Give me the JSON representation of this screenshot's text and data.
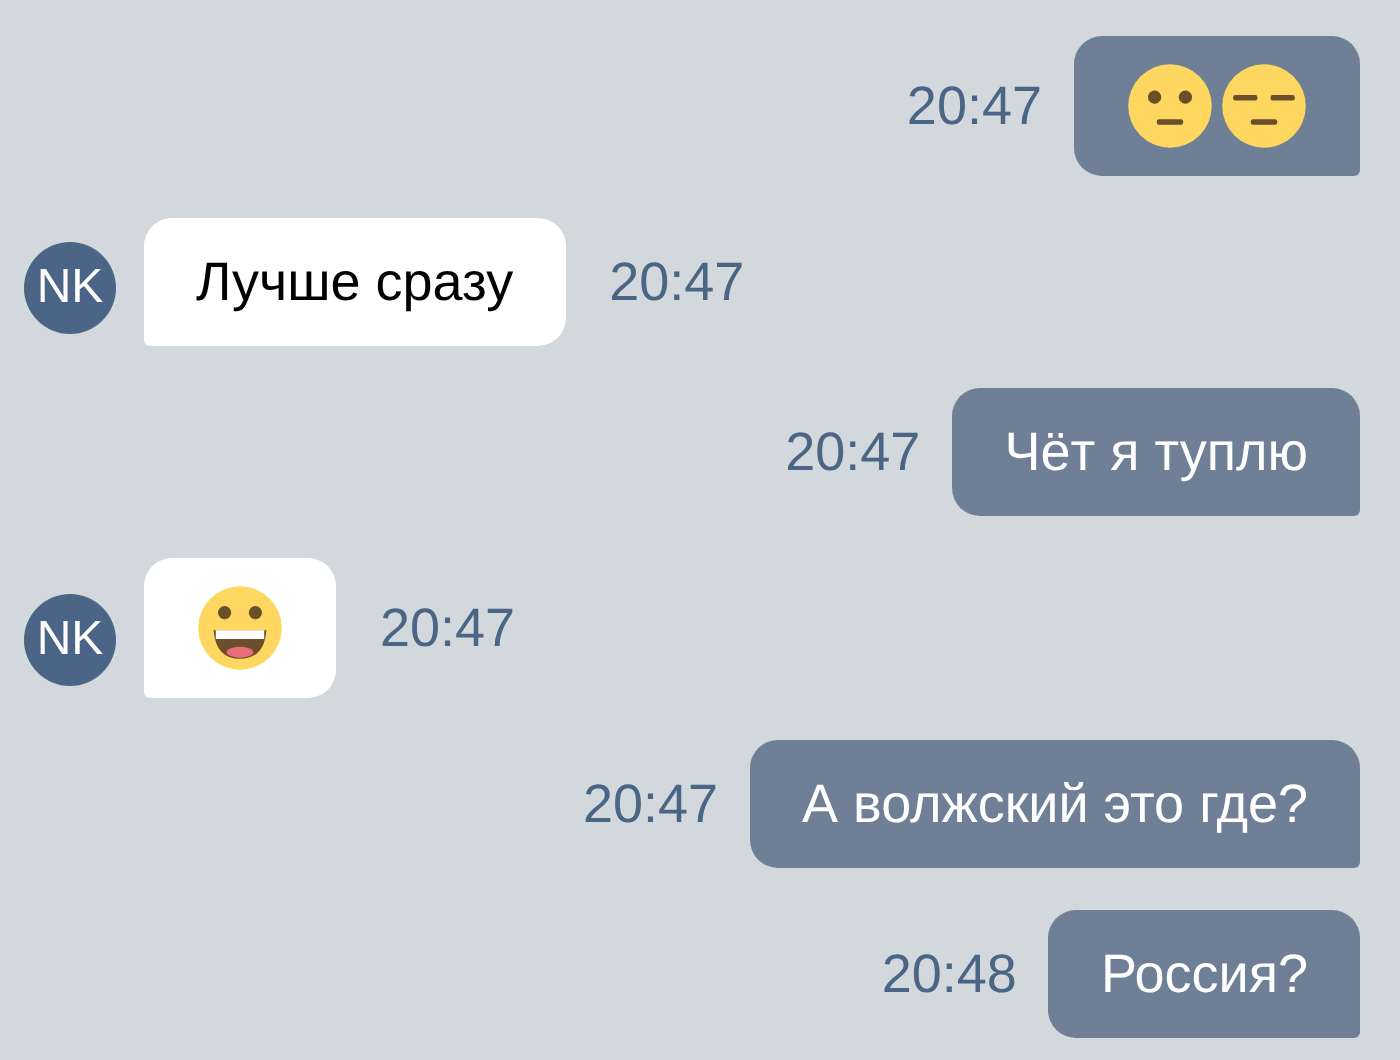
{
  "messages": [
    {
      "outgoing": true,
      "kind": "emoji_pair",
      "time": "20:47"
    },
    {
      "outgoing": false,
      "kind": "text",
      "avatar": "NK",
      "text": "Лучше сразу",
      "time": "20:47"
    },
    {
      "outgoing": true,
      "kind": "text",
      "text": "Чёт я туплю",
      "time": "20:47"
    },
    {
      "outgoing": false,
      "kind": "emoji_grin",
      "avatar": "NK",
      "time": "20:47"
    },
    {
      "outgoing": true,
      "kind": "text",
      "text": "А волжский это где?",
      "time": "20:47"
    },
    {
      "outgoing": true,
      "kind": "text",
      "text": "Россия?",
      "time": "20:48"
    }
  ]
}
